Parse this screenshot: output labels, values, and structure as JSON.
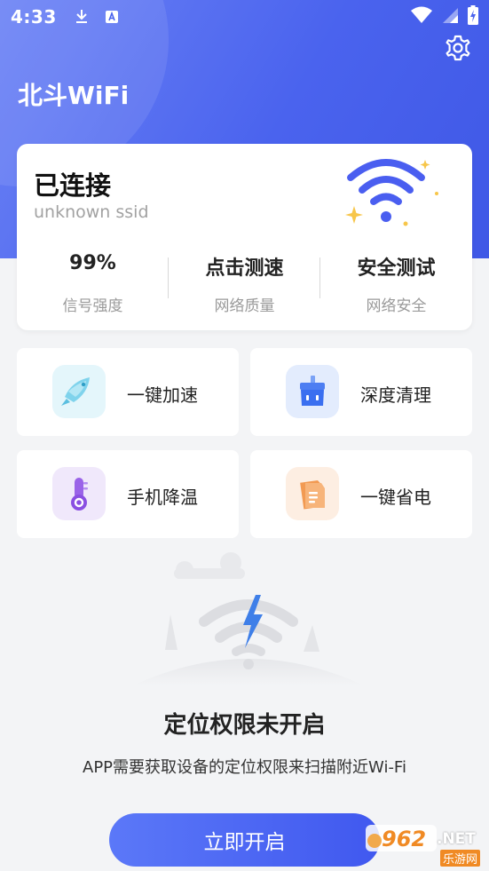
{
  "status_bar": {
    "time": "4:33",
    "icons": [
      "download-icon",
      "font-icon",
      "wifi-signal-icon",
      "cell-signal-icon",
      "battery-charging-icon"
    ]
  },
  "header": {
    "title": "北斗WiFi",
    "settings_icon": "gear-icon"
  },
  "connection_card": {
    "status": "已连接",
    "ssid": "unknown ssid",
    "stats": [
      {
        "value": "99%",
        "label": "信号强度"
      },
      {
        "value": "点击测速",
        "label": "网络质量"
      },
      {
        "value": "安全测试",
        "label": "网络安全"
      }
    ]
  },
  "tools": [
    {
      "label": "一键加速",
      "icon": "rocket-icon"
    },
    {
      "label": "深度清理",
      "icon": "broom-icon"
    },
    {
      "label": "手机降温",
      "icon": "thermometer-icon"
    },
    {
      "label": "一键省电",
      "icon": "battery-saver-icon"
    }
  ],
  "permission": {
    "title": "定位权限未开启",
    "description": "APP需要获取设备的定位权限来扫描附近Wi-Fi",
    "button_label": "立即开启"
  },
  "watermark": {
    "number": "962",
    "suffix": ".NET",
    "cn": "乐游网"
  },
  "colors": {
    "primary": "#4a63ee",
    "header_light": "#6b82f5",
    "background": "#f3f4f6",
    "wifi_icon": "#4a5ef0",
    "sparkle": "#f7c64a"
  }
}
